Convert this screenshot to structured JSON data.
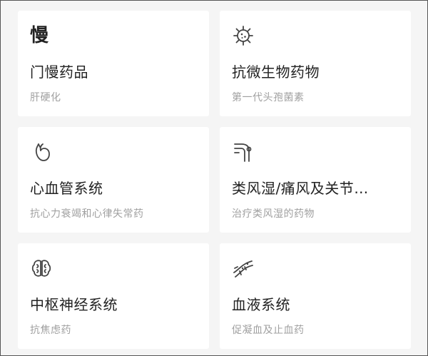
{
  "categories": [
    {
      "icon": "chronic-char-icon",
      "icon_glyph": "慢",
      "title": "门慢药品",
      "subtitle": "肝硬化"
    },
    {
      "icon": "bacteria-icon",
      "title": "抗微生物药物",
      "subtitle": "第一代头孢菌素"
    },
    {
      "icon": "heart-icon",
      "title": "心血管系统",
      "subtitle": "抗心力衰竭和心律失常药"
    },
    {
      "icon": "joint-icon",
      "title": "类风湿/痛风及关节…",
      "subtitle": "治疗类风湿的药物"
    },
    {
      "icon": "brain-icon",
      "title": "中枢神经系统",
      "subtitle": "抗焦虑药"
    },
    {
      "icon": "blood-vessel-icon",
      "title": "血液系统",
      "subtitle": "促凝血及止血药"
    }
  ],
  "colors": {
    "background": "#f5f5f5",
    "card": "#ffffff",
    "title": "#222222",
    "subtitle": "#a0a0a0",
    "icon_stroke": "#444444"
  }
}
